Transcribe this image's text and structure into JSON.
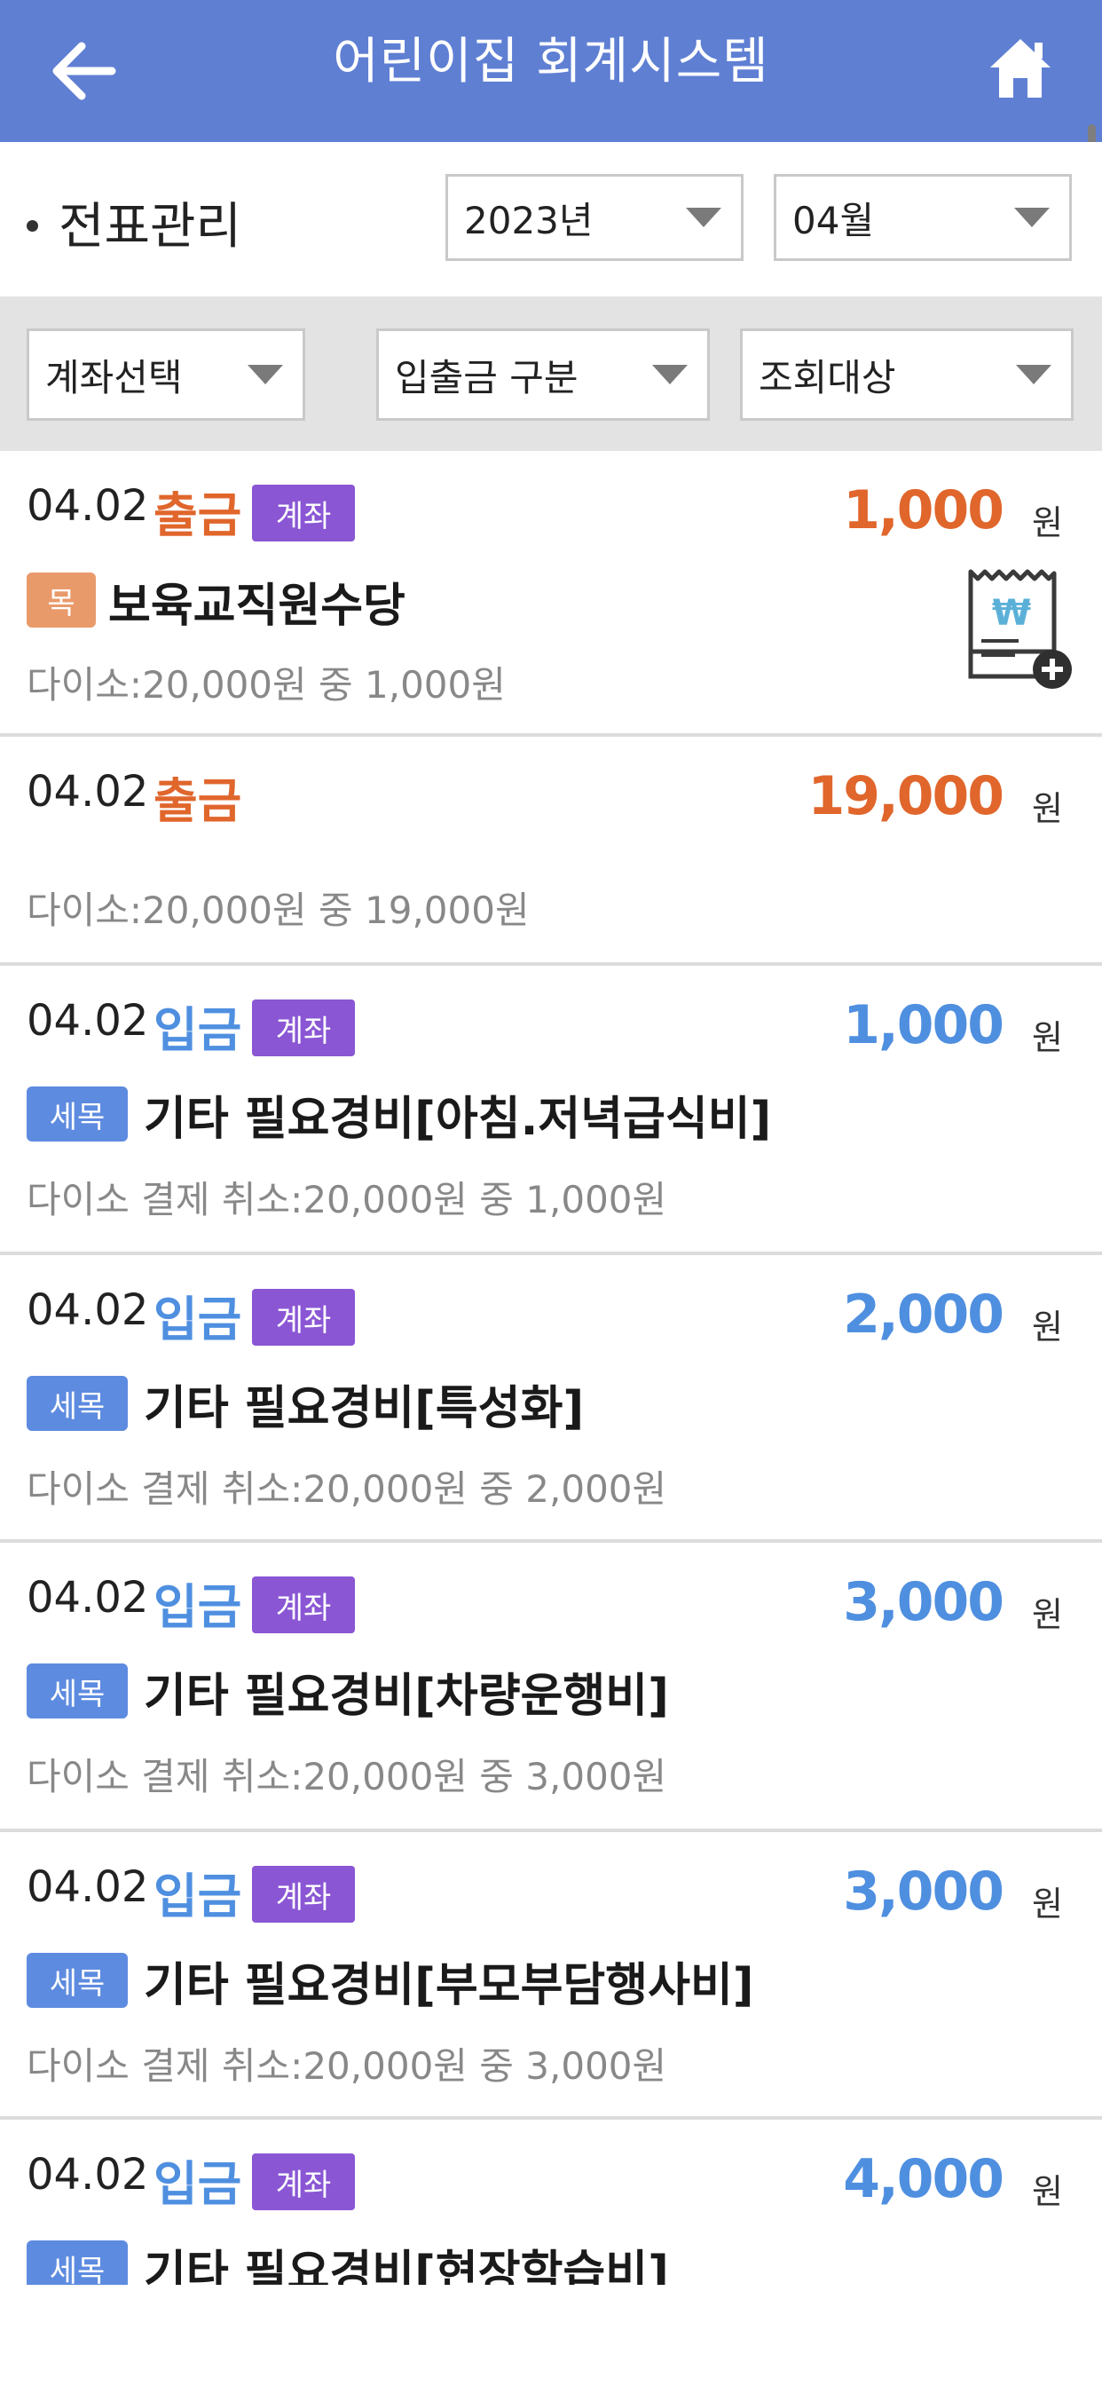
{
  "header": {
    "title": "어린이집 회계시스템",
    "back_icon": "arrow-left-icon",
    "home_icon": "home-icon",
    "color": "#5f7fd3"
  },
  "filters": {
    "section_label": "전표관리",
    "year": "2023년",
    "month": "04월",
    "account_select": "계좌선택",
    "inout_select": "입출금 구분",
    "target_select": "조회대상"
  },
  "colors": {
    "out": "#e0662c",
    "in": "#4f8fe0",
    "account_badge": "#8a56d4",
    "mok_tag": "#e99a6b",
    "semok_tag": "#5d8be0"
  },
  "items": [
    {
      "date": "04.02",
      "type": "출금",
      "badge": "계좌",
      "amount": "1,000",
      "unit": "원",
      "tag": "목",
      "name": "보육교직원수당",
      "desc": "다이소:20,000원 중 1,000원",
      "receipt_icon": "receipt-add-icon"
    },
    {
      "date": "04.02",
      "type": "출금",
      "badge": "",
      "amount": "19,000",
      "unit": "원",
      "tag": "",
      "name": "",
      "desc": "다이소:20,000원 중 19,000원"
    },
    {
      "date": "04.02",
      "type": "입금",
      "badge": "계좌",
      "amount": "1,000",
      "unit": "원",
      "tag": "세목",
      "name": "기타 필요경비[아침.저녁급식비]",
      "desc": "다이소 결제 취소:20,000원 중 1,000원"
    },
    {
      "date": "04.02",
      "type": "입금",
      "badge": "계좌",
      "amount": "2,000",
      "unit": "원",
      "tag": "세목",
      "name": "기타 필요경비[특성화]",
      "desc": "다이소 결제 취소:20,000원 중 2,000원"
    },
    {
      "date": "04.02",
      "type": "입금",
      "badge": "계좌",
      "amount": "3,000",
      "unit": "원",
      "tag": "세목",
      "name": "기타 필요경비[차량운행비]",
      "desc": "다이소 결제 취소:20,000원 중 3,000원"
    },
    {
      "date": "04.02",
      "type": "입금",
      "badge": "계좌",
      "amount": "3,000",
      "unit": "원",
      "tag": "세목",
      "name": "기타 필요경비[부모부담행사비]",
      "desc": "다이소 결제 취소:20,000원 중 3,000원"
    },
    {
      "date": "04.02",
      "type": "입금",
      "badge": "계좌",
      "amount": "4,000",
      "unit": "원",
      "tag": "세목",
      "name": "기타 필요경비[현장학습비]",
      "desc": ""
    }
  ]
}
